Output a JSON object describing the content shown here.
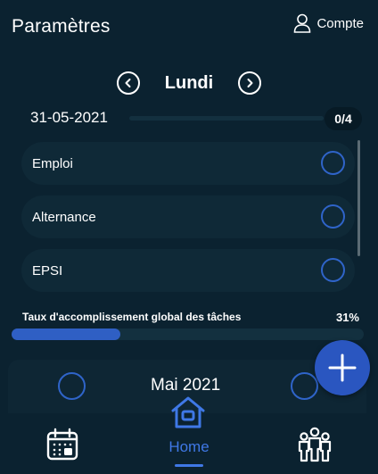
{
  "header": {
    "title": "Paramètres",
    "account_label": "Compte"
  },
  "day_nav": {
    "day": "Lundi"
  },
  "date_row": {
    "date": "31-05-2021",
    "count": "0/4"
  },
  "tasks": [
    {
      "label": "Emploi",
      "done": false
    },
    {
      "label": "Alternance",
      "done": false
    },
    {
      "label": "EPSI",
      "done": false
    }
  ],
  "global_progress": {
    "label": "Taux d'accomplissement global des tâches",
    "percent_text": "31%",
    "value": 0.31
  },
  "calendar": {
    "month": "Mai 2021"
  },
  "bottom_nav": {
    "home_label": "Home"
  },
  "colors": {
    "background": "#0b2230",
    "accent": "#2f5fc4",
    "nav_active": "#3f78e6"
  },
  "icons": [
    "user-icon",
    "chevron-left-icon",
    "chevron-right-icon",
    "plus-icon",
    "calendar-icon",
    "home-icon",
    "people-icon"
  ]
}
